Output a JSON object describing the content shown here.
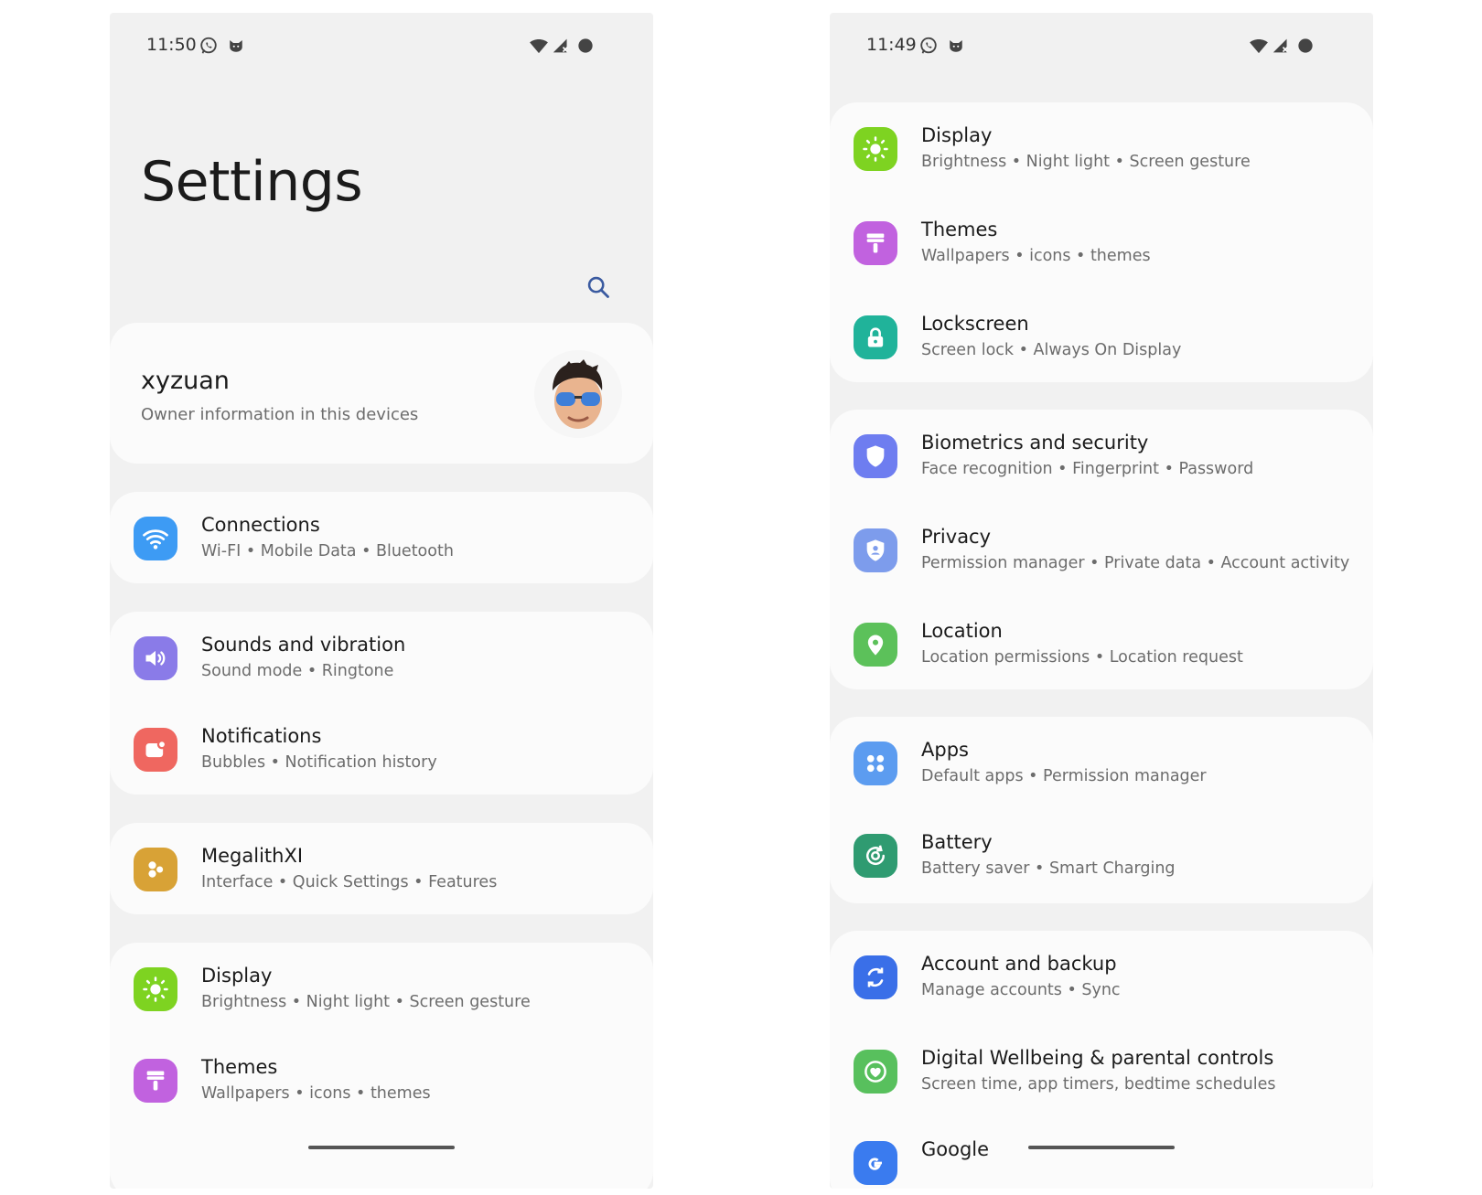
{
  "left": {
    "status": {
      "time": "11:50"
    },
    "page_title": "Settings",
    "profile": {
      "name": "xyzuan",
      "subtitle": "Owner information in this devices"
    },
    "items": [
      {
        "title": "Connections",
        "subtitle": "Wi-FI • Mobile Data • Bluetooth",
        "icon": "wifi-icon",
        "color": "#3d9bf4"
      },
      {
        "title": "Sounds and vibration",
        "subtitle": "Sound mode • Ringtone",
        "icon": "volume-icon",
        "color": "#8a7be8"
      },
      {
        "title": "Notifications",
        "subtitle": "Bubbles • Notification history",
        "icon": "notification-icon",
        "color": "#ef6760"
      },
      {
        "title": "MegalithXI",
        "subtitle": "Interface • Quick Settings • Features",
        "icon": "megalith-icon",
        "color": "#d8a236"
      },
      {
        "title": "Display",
        "subtitle": "Brightness • Night light • Screen gesture",
        "icon": "brightness-icon",
        "color": "#7ed321"
      },
      {
        "title": "Themes",
        "subtitle": "Wallpapers • icons • themes",
        "icon": "brush-icon",
        "color": "#c162df"
      }
    ]
  },
  "right": {
    "status": {
      "time": "11:49"
    },
    "items": [
      {
        "title": "Display",
        "subtitle": "Brightness • Night light • Screen gesture",
        "icon": "brightness-icon",
        "color": "#7ed321"
      },
      {
        "title": "Themes",
        "subtitle": "Wallpapers • icons • themes",
        "icon": "brush-icon",
        "color": "#c162df"
      },
      {
        "title": "Lockscreen",
        "subtitle": "Screen lock • Always On Display",
        "icon": "lock-icon",
        "color": "#20b39a"
      },
      {
        "title": "Biometrics and security",
        "subtitle": "Face recognition • Fingerprint • Password",
        "icon": "shield-icon",
        "color": "#6e7df0"
      },
      {
        "title": "Privacy",
        "subtitle": "Permission manager • Private data • Account activity",
        "icon": "privacy-icon",
        "color": "#7d9cec"
      },
      {
        "title": "Location",
        "subtitle": "Location permissions • Location request",
        "icon": "location-pin-icon",
        "color": "#5cc15a"
      },
      {
        "title": "Apps",
        "subtitle": "Default apps • Permission manager",
        "icon": "apps-grid-icon",
        "color": "#5c9cf0"
      },
      {
        "title": "Battery",
        "subtitle": "Battery saver • Smart Charging",
        "icon": "battery-icon",
        "color": "#2f9b71"
      },
      {
        "title": "Account and backup",
        "subtitle": "Manage accounts • Sync",
        "icon": "sync-icon",
        "color": "#3a6fe8"
      },
      {
        "title": "Digital Wellbeing & parental controls",
        "subtitle": "Screen time, app timers, bedtime schedules",
        "icon": "wellbeing-icon",
        "color": "#58c05d"
      },
      {
        "title": "Google",
        "subtitle": "",
        "icon": "google-icon",
        "color": "#3a7bef"
      }
    ]
  }
}
